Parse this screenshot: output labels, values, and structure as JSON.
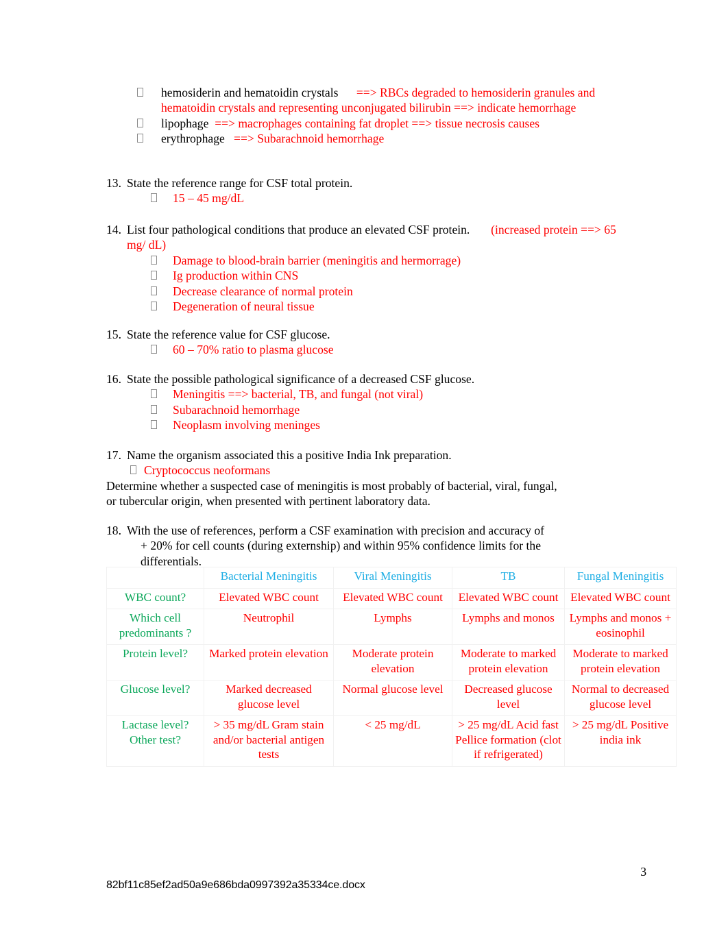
{
  "document": {
    "page_number": "3",
    "filename": "82bf11c85ef2ad50a9e686bda0997392a35334ce.docx",
    "colors": {
      "answer_red": "#ff0000",
      "row_label_green": "#0ba75a",
      "header_blue": "#1cade4",
      "question_black": "#000000",
      "cell_border": "#f1f1f1"
    }
  },
  "top_bullets": [
    {
      "question": "hemosiderin and hematoidin crystals",
      "answer": "==> RBCs degraded to hemosiderin granules and hematoidin crystals and representing unconjugated bilirubin ==> indicate hemorrhage"
    },
    {
      "question": "lipophage",
      "answer": "==> macrophages containing fat droplet ==> tissue necrosis causes"
    },
    {
      "question": "erythrophage",
      "answer": "==> Subarachnoid hemorrhage"
    }
  ],
  "items": {
    "q13": {
      "number": "13.",
      "question": "State the reference range for CSF total protein.",
      "answers": [
        "15 – 45 mg/dL"
      ]
    },
    "q14": {
      "number": "14.",
      "question": "List four pathological conditions that produce an elevated CSF protein.",
      "inline_note": "(increased protein ==> 65 mg/ dL)",
      "answers": [
        "Damage to blood-brain barrier (meningitis and hermorrage)",
        "Ig production within CNS",
        "Decrease clearance of normal protein",
        "Degeneration of neural tissue"
      ]
    },
    "q15": {
      "number": "15.",
      "question": "State the reference value for CSF glucose.",
      "answers": [
        "60 – 70% ratio to plasma glucose"
      ]
    },
    "q16": {
      "number": "16.",
      "question": "State the possible pathological significance of a decreased CSF glucose.",
      "answers": [
        "Meningitis ==> bacterial, TB, and fungal (not viral)",
        "Subarachnoid hemorrhage",
        "Neoplasm involving meninges"
      ]
    },
    "q17": {
      "number": "17.",
      "question": "Name the organism associated this a positive India Ink preparation.",
      "answers": [
        "Cryptococcus neoformans"
      ],
      "trailing_paragraph": "Determine whether a suspected case of meningitis is most probably of bacterial, viral, fungal, or tubercular origin, when presented with pertinent laboratory data."
    },
    "q18": {
      "number": "18.",
      "question_line1": "With the use of references, perform a CSF examination with precision and accuracy of",
      "question_line2": "+ 20% for cell counts (during externship) and within 95% confidence limits for the",
      "question_line3": "differentials."
    }
  },
  "table": {
    "corner": "",
    "column_headers": [
      "Bacterial Meningitis",
      "Viral Meningitis",
      "TB",
      "Fungal Meningitis"
    ],
    "rows": [
      {
        "label": "WBC count?",
        "cells": [
          "Elevated WBC count",
          "Elevated WBC count",
          "Elevated WBC count",
          "Elevated WBC count"
        ]
      },
      {
        "label": "Which cell predominants ?",
        "cells": [
          "Neutrophil",
          "Lymphs",
          "Lymphs and monos",
          "Lymphs and monos + eosinophil"
        ]
      },
      {
        "label": "Protein level?",
        "cells": [
          "Marked protein elevation",
          "Moderate protein elevation",
          "Moderate to marked protein elevation",
          "Moderate to marked protein elevation"
        ]
      },
      {
        "label": "Glucose level?",
        "cells": [
          "Marked decreased glucose level",
          "Normal glucose level",
          "Decreased glucose level",
          "Normal to decreased glucose level"
        ]
      },
      {
        "label": "Lactase level? Other test?",
        "cells": [
          "> 35 mg/dL Gram stain and/or bacterial antigen tests",
          "< 25 mg/dL",
          "> 25 mg/dL Acid fast Pellice formation (clot if refrigerated)",
          "> 25 mg/dL Positive india ink"
        ]
      }
    ]
  }
}
